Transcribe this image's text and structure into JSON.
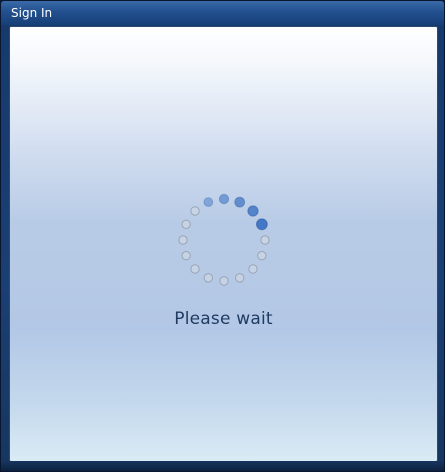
{
  "window": {
    "title": "Sign In"
  },
  "status": {
    "message": "Please wait"
  },
  "icons": {
    "spinner": "loading-spinner-icon"
  },
  "colors": {
    "accent": "#3d73c4",
    "inactive_dot": "#d4dbe4"
  }
}
